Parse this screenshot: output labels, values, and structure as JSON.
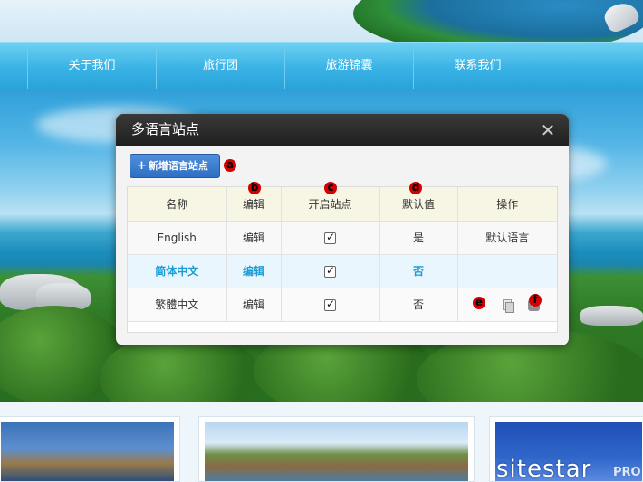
{
  "nav": {
    "items": [
      "关于我们",
      "旅行团",
      "旅游锦囊",
      "联系我们"
    ]
  },
  "brand": {
    "name": "sitestar",
    "suffix": "PRO"
  },
  "dialog": {
    "title": "多语言站点",
    "close_label": "✕",
    "add_button": {
      "icon": "+",
      "label": "新增语言站点"
    },
    "columns": [
      "名称",
      "编辑",
      "开启站点",
      "默认值",
      "操作"
    ],
    "rows": [
      {
        "name": "English",
        "edit": "编辑",
        "enabled": true,
        "default": "是",
        "action_text": "默认语言",
        "highlight": false
      },
      {
        "name": "简体中文",
        "edit": "编辑",
        "enabled": true,
        "default": "否",
        "action_text": "",
        "highlight": true
      },
      {
        "name": "繁體中文",
        "edit": "编辑",
        "enabled": true,
        "default": "否",
        "action_text": "",
        "highlight": false
      }
    ],
    "delete_label": "✕"
  },
  "markers": [
    "a",
    "b",
    "c",
    "d",
    "e",
    "f"
  ],
  "colors": {
    "accent": "#2f6fc2",
    "highlight_text": "#1a9bd4",
    "marker": "#d50000",
    "nav": "#39b3e6",
    "dialog_header": "#2a2a2a"
  }
}
